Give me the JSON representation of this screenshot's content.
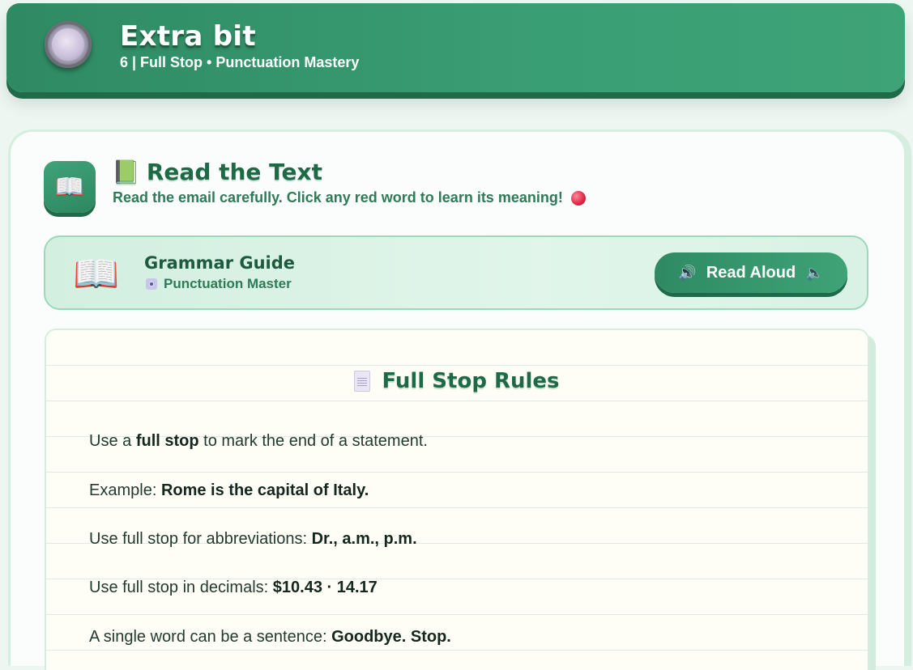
{
  "header": {
    "title": "Extra bit",
    "subtitle": "6  |  Full Stop • Punctuation Mastery"
  },
  "section": {
    "title": "Read the Text",
    "instruction": "Read the email carefully. Click any red word to learn its meaning!"
  },
  "guide": {
    "title": "Grammar Guide",
    "subtitle": "Punctuation Master",
    "read_aloud_label": "Read Aloud"
  },
  "rules": {
    "title": "Full Stop Rules",
    "items": [
      {
        "prefix": "Use a ",
        "bold": "full stop",
        "suffix": " to mark the end of a statement."
      },
      {
        "prefix": "Example: ",
        "bold": "Rome is the capital of Italy.",
        "suffix": ""
      },
      {
        "prefix": "Use full stop for abbreviations: ",
        "bold": "Dr., a.m., p.m.",
        "suffix": ""
      },
      {
        "prefix": "Use full stop in decimals: ",
        "bold": "$10.43 · 14.17",
        "suffix": ""
      },
      {
        "prefix": "A single word can be a sentence: ",
        "bold": "Goodbye. Stop.",
        "suffix": ""
      }
    ]
  },
  "colors": {
    "brand_green": "#2f8a63",
    "dark_green": "#1e6a46",
    "accent_red": "#e02d4a"
  },
  "icons": {
    "header_badge": "badge-medal-icon",
    "section": "open-book-icon",
    "speaker": "speaker-icon",
    "document": "document-icon",
    "disc": "disc-icon",
    "red_dot": "red-circle-icon"
  }
}
